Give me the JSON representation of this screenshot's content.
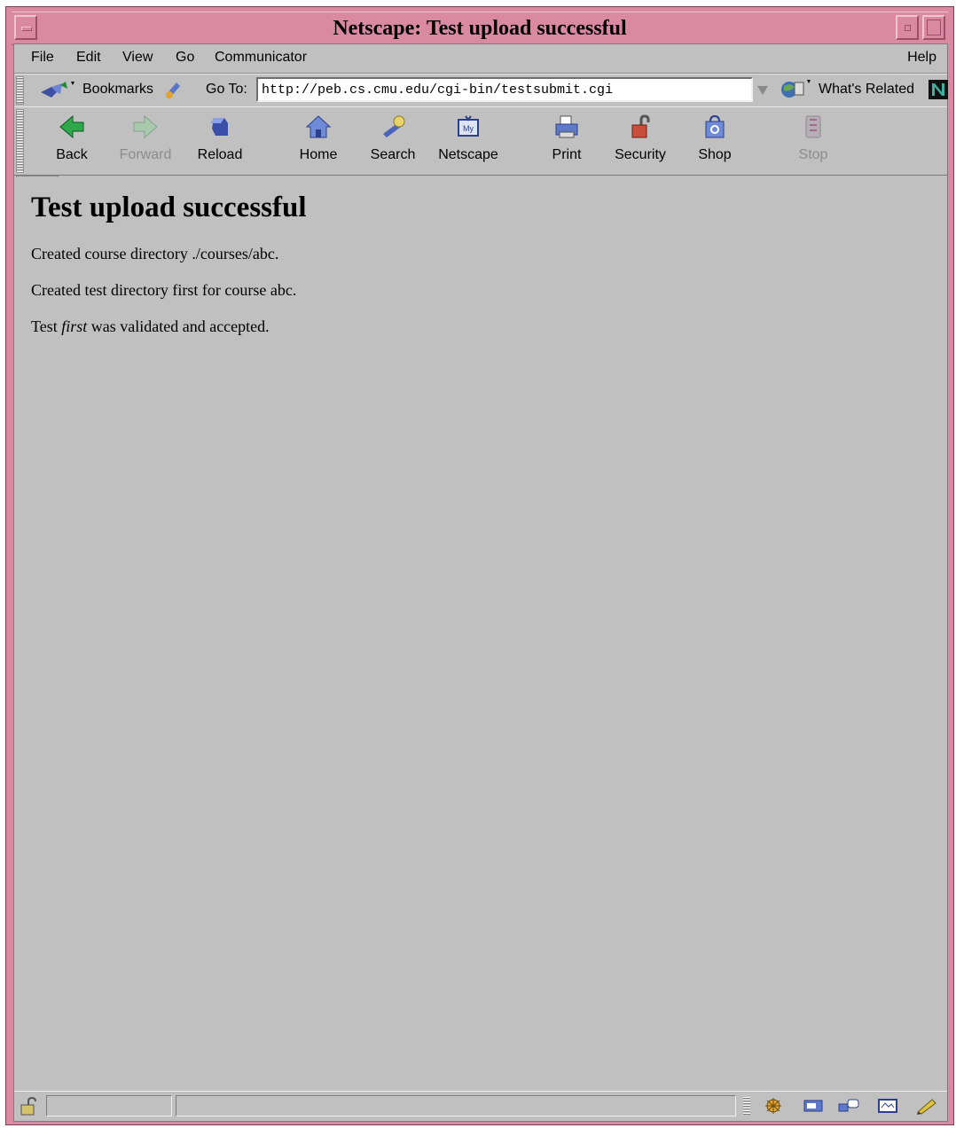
{
  "window": {
    "title": "Netscape: Test upload successful"
  },
  "menubar": {
    "file": "File",
    "edit": "Edit",
    "view": "View",
    "go": "Go",
    "communicator": "Communicator",
    "help": "Help"
  },
  "location": {
    "bookmarks": "Bookmarks",
    "goto_label": "Go To:",
    "url": "http://peb.cs.cmu.edu/cgi-bin/testsubmit.cgi",
    "whats_related": "What's Related"
  },
  "toolbar": {
    "back": "Back",
    "forward": "Forward",
    "reload": "Reload",
    "home": "Home",
    "search": "Search",
    "netscape": "Netscape",
    "print": "Print",
    "security": "Security",
    "shop": "Shop",
    "stop": "Stop"
  },
  "page": {
    "heading": "Test upload successful",
    "line1": "Created course directory ./courses/abc.",
    "line2": "Created test directory first for course abc.",
    "line3_prefix": "Test ",
    "line3_italic": "first",
    "line3_suffix": " was validated and accepted."
  },
  "colors": {
    "window_frame": "#d98aa2",
    "chrome": "#c0c0c0"
  }
}
